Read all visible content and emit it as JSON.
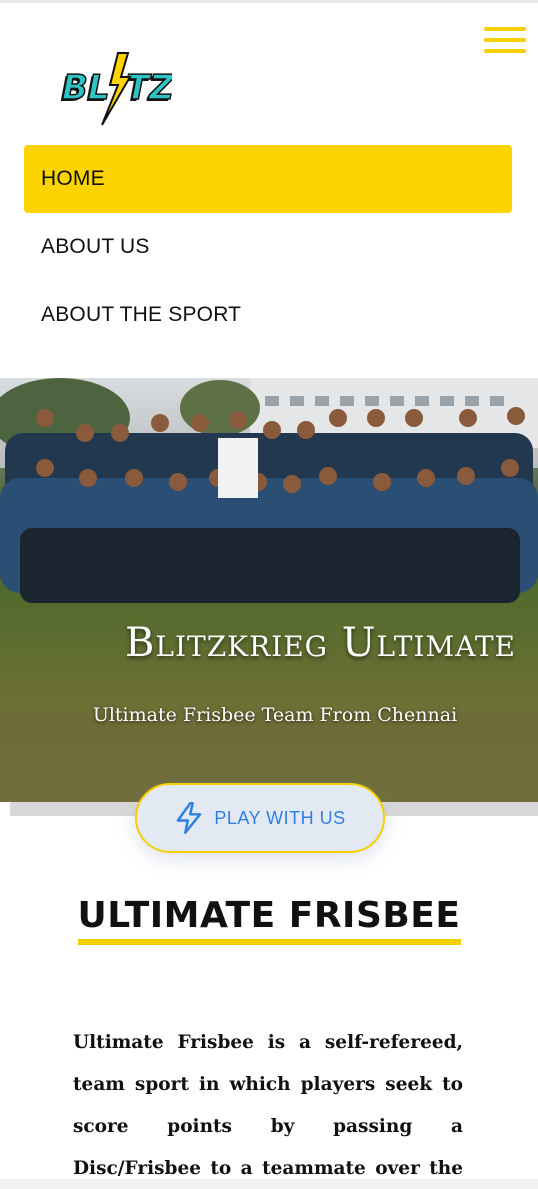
{
  "header": {
    "logo_text": "BL TZ",
    "menu_icon": "hamburger-menu-icon"
  },
  "nav": {
    "items": [
      {
        "label": "HOME",
        "active": true
      },
      {
        "label": "ABOUT US",
        "active": false
      },
      {
        "label": "ABOUT THE SPORT",
        "active": false
      }
    ]
  },
  "hero": {
    "title": "Blitzkrieg Ultimate",
    "subtitle": "Ultimate Frisbee Team From Chennai"
  },
  "cta": {
    "label": "PLAY WITH US",
    "icon": "lightning-bolt-icon"
  },
  "section": {
    "title": "ULTIMATE FRISBEE",
    "paragraph": "Ultimate Frisbee is a self-refereed, team sport in which players seek to score points by passing a Disc/Frisbee to a teammate over the opposing team’s"
  },
  "colors": {
    "accent": "#fdd400",
    "cta_text": "#2f7fe0",
    "cta_bg": "#e3e9f2"
  }
}
